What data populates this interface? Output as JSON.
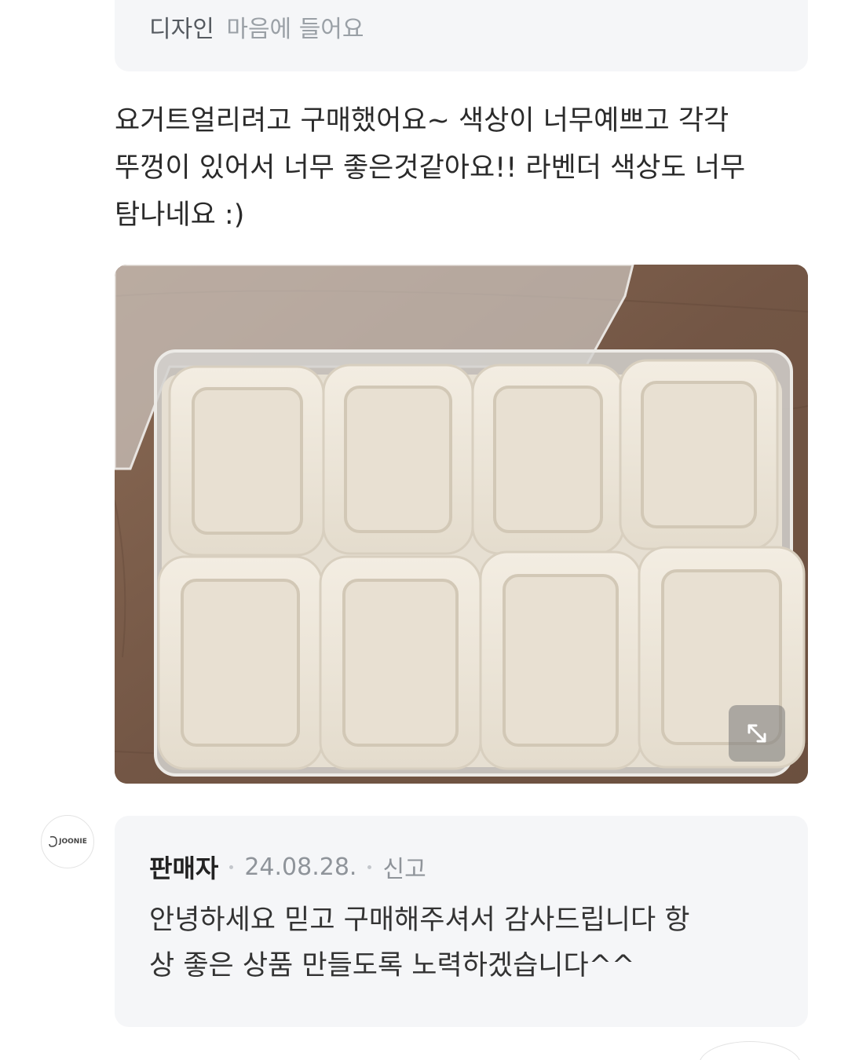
{
  "opinion": {
    "key": "디자인",
    "value": "마음에 들어요"
  },
  "review": {
    "text": "요거트얼리려고 구매했어요~ 색상이 너무예쁘고 각각\n뚜껑이 있어서 너무 좋은것같아요!! 라벤더 색상도 너무\n탐나네요 :)"
  },
  "photo": {
    "expand_icon": "expand-arrows-icon"
  },
  "seller_reply": {
    "avatar_logo": "JOONIE",
    "author": "판매자",
    "date": "24.08.28.",
    "report_label": "신고",
    "text": "안녕하세요 믿고 구매해주셔서 감사드립니다 항\n상 좋은 상품 만들도록 노력하겠습니다^^"
  },
  "colors": {
    "bubble_bg": "#f5f6f8",
    "lid_color": "#ece4d6",
    "table_wood": "#7a5d49"
  }
}
